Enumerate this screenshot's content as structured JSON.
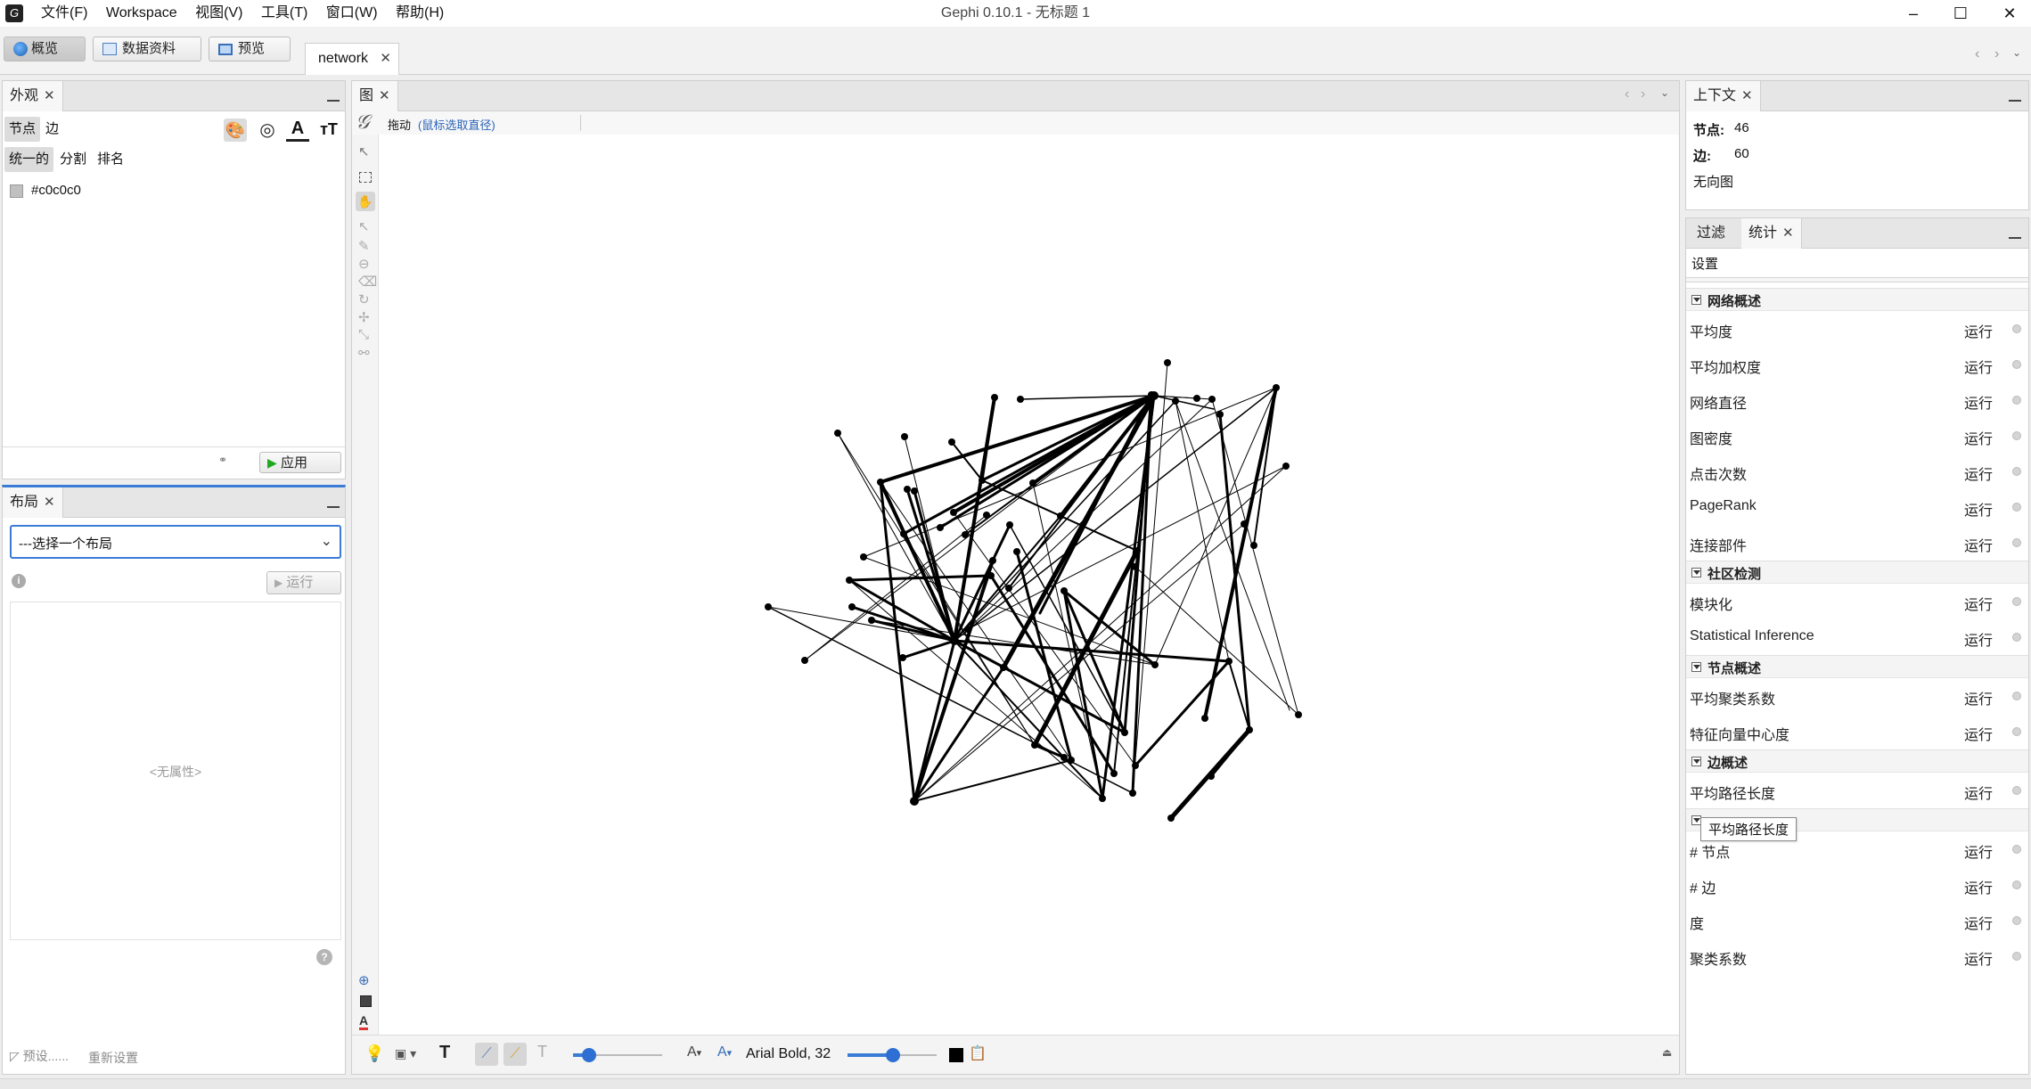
{
  "window": {
    "title": "Gephi 0.10.1 - 无标题 1",
    "controls": {
      "minimize": "–",
      "maximize": "☐",
      "close": "✕"
    }
  },
  "menu": [
    "文件(F)",
    "Workspace",
    "视图(V)",
    "工具(T)",
    "窗口(W)",
    "帮助(H)"
  ],
  "toolbar": {
    "overview": "概览",
    "data_lab": "数据资料",
    "preview": "预览",
    "workspace_tab": "network"
  },
  "appearance": {
    "tab": "外观",
    "subtabs": [
      "节点",
      "边"
    ],
    "modes": [
      "统一的",
      "分割",
      "排名"
    ],
    "color_value": "#c0c0c0",
    "apply": "应用"
  },
  "layout_panel": {
    "tab": "布局",
    "select_placeholder": "---选择一个布局",
    "run": "运行",
    "no_props": "<无属性>",
    "presets": "预设......",
    "reset": "重新设置"
  },
  "graph": {
    "tab": "图",
    "mode_label": "拖动",
    "mode_hint": "(鼠标选取直径)",
    "font_label": "Arial Bold, 32"
  },
  "context": {
    "tab": "上下文",
    "nodes_label": "节点:",
    "nodes_value": "46",
    "edges_label": "边:",
    "edges_value": "60",
    "graph_type": "无向图"
  },
  "stats_panel": {
    "tabs": [
      "过滤",
      "统计"
    ],
    "settings": "设置",
    "run_label": "运行",
    "sections": [
      {
        "title": "网络概述",
        "items": [
          "平均度",
          "平均加权度",
          "网络直径",
          "图密度",
          "点击次数",
          "PageRank",
          "连接部件"
        ]
      },
      {
        "title": "社区检测",
        "items": [
          "模块化",
          "Statistical Inference"
        ]
      },
      {
        "title": "节点概述",
        "items": [
          "平均聚类系数",
          "特征向量中心度"
        ]
      },
      {
        "title": "边概述",
        "items": [
          "平均路径长度"
        ]
      }
    ],
    "extra_items": [
      "# 节点",
      "# 边",
      "度",
      "聚类系数"
    ],
    "tooltip": "平均路径长度"
  }
}
